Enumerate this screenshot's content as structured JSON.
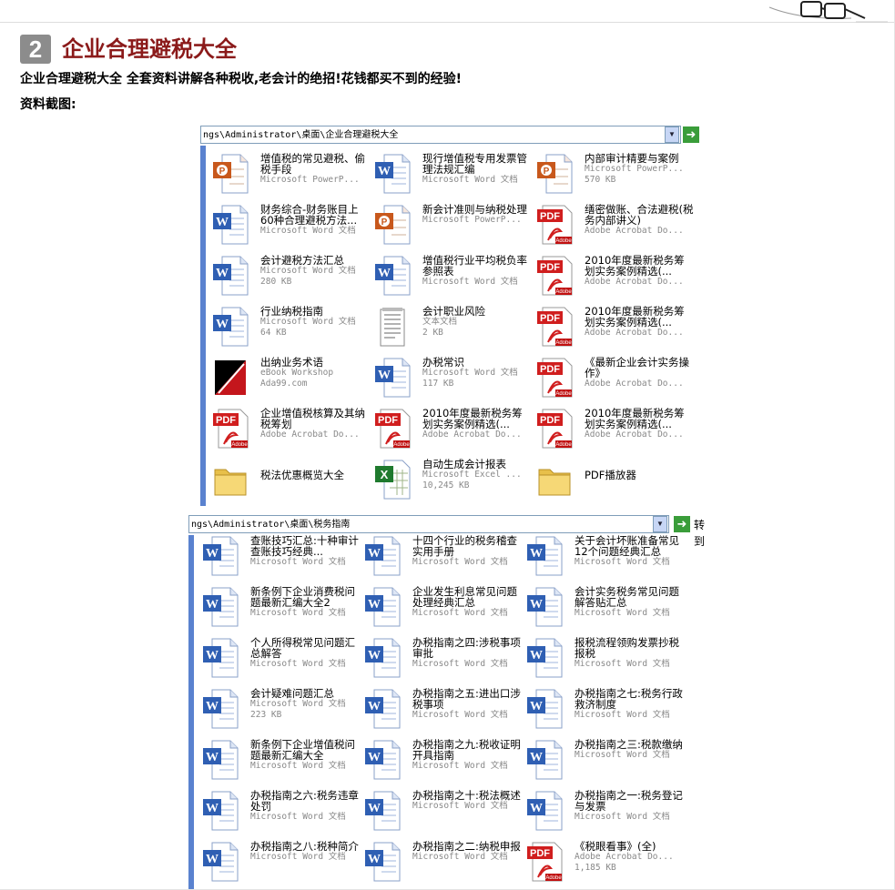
{
  "section": {
    "number": "2",
    "title": "企业合理避税大全"
  },
  "description": "企业合理避税大全 全套资料讲解各种税收,老会计的绝招!花钱都买不到的经验!",
  "screenshots_label": "资料截图:",
  "explorer1": {
    "address": "ngs\\Administrator\\桌面\\企业合理避税大全",
    "items": [
      {
        "icon": "ppt",
        "name": "增值税的常见避税、偷税手段",
        "meta1": "Microsoft PowerP...",
        "meta2": ""
      },
      {
        "icon": "word",
        "name": "现行增值税专用发票管理法规汇编",
        "meta1": "Microsoft Word 文档",
        "meta2": ""
      },
      {
        "icon": "ppt",
        "name": "内部审计精要与案例",
        "meta1": "Microsoft PowerP...",
        "meta2": "570 KB"
      },
      {
        "icon": "word",
        "name": "财务综合-财务账目上60种合理避税方法...",
        "meta1": "Microsoft Word 文档",
        "meta2": ""
      },
      {
        "icon": "ppt",
        "name": "新会计准则与纳税处理",
        "meta1": "Microsoft PowerP...",
        "meta2": ""
      },
      {
        "icon": "pdf",
        "name": "缮密做账、合法避税(税务内部讲义)",
        "meta1": "Adobe Acrobat Do...",
        "meta2": ""
      },
      {
        "icon": "word",
        "name": "会计避税方法汇总",
        "meta1": "Microsoft Word 文档",
        "meta2": "280 KB"
      },
      {
        "icon": "word",
        "name": "增值税行业平均税负率参照表",
        "meta1": "Microsoft Word 文档",
        "meta2": ""
      },
      {
        "icon": "pdf",
        "name": "2010年度最新税务筹划实务案例精选(...",
        "meta1": "Adobe Acrobat Do...",
        "meta2": ""
      },
      {
        "icon": "word",
        "name": "行业纳税指南",
        "meta1": "Microsoft Word 文档",
        "meta2": "64 KB"
      },
      {
        "icon": "txt",
        "name": "会计职业风险",
        "meta1": "文本文档",
        "meta2": "2 KB"
      },
      {
        "icon": "pdf",
        "name": "2010年度最新税务筹划实务案例精选(...",
        "meta1": "Adobe Acrobat Do...",
        "meta2": ""
      },
      {
        "icon": "ebook",
        "name": "出纳业务术语",
        "meta1": "eBook Workshop",
        "meta2": "Ada99.com"
      },
      {
        "icon": "word",
        "name": "办税常识",
        "meta1": "Microsoft Word 文档",
        "meta2": "117 KB"
      },
      {
        "icon": "pdf",
        "name": "《最新企业会计实务操作》",
        "meta1": "Adobe Acrobat Do...",
        "meta2": ""
      },
      {
        "icon": "pdf",
        "name": "企业增值税核算及其纳税筹划",
        "meta1": "Adobe Acrobat Do...",
        "meta2": ""
      },
      {
        "icon": "pdf",
        "name": "2010年度最新税务筹划实务案例精选(...",
        "meta1": "Adobe Acrobat Do...",
        "meta2": ""
      },
      {
        "icon": "pdf",
        "name": "2010年度最新税务筹划实务案例精选(...",
        "meta1": "Adobe Acrobat Do...",
        "meta2": ""
      },
      {
        "icon": "folder",
        "name": "税法优惠概览大全",
        "meta1": "",
        "meta2": ""
      },
      {
        "icon": "excel",
        "name": "自动生成会计报表",
        "meta1": "Microsoft Excel ...",
        "meta2": "10,245 KB"
      },
      {
        "icon": "folder",
        "name": "PDF播放器",
        "meta1": "",
        "meta2": ""
      }
    ]
  },
  "explorer2": {
    "address": "ngs\\Administrator\\桌面\\税务指南",
    "go_label": "转到",
    "items": [
      {
        "icon": "word",
        "name": "查账技巧汇总:十种审计查账技巧经典...",
        "meta1": "Microsoft Word 文档",
        "meta2": ""
      },
      {
        "icon": "word",
        "name": "十四个行业的税务稽查实用手册",
        "meta1": "Microsoft Word 文档",
        "meta2": ""
      },
      {
        "icon": "word",
        "name": "关于会计坏账准备常见12个问题经典汇总",
        "meta1": "Microsoft Word 文档",
        "meta2": ""
      },
      {
        "icon": "word",
        "name": "新条例下企业消费税问题最新汇编大全2",
        "meta1": "Microsoft Word 文档",
        "meta2": ""
      },
      {
        "icon": "word",
        "name": "企业发生利息常见问题处理经典汇总",
        "meta1": "Microsoft Word 文档",
        "meta2": ""
      },
      {
        "icon": "word",
        "name": "会计实务税务常见问题解答贴汇总",
        "meta1": "Microsoft Word 文档",
        "meta2": ""
      },
      {
        "icon": "word",
        "name": "个人所得税常见问题汇总解答",
        "meta1": "Microsoft Word 文档",
        "meta2": ""
      },
      {
        "icon": "word",
        "name": "办税指南之四:涉税事项审批",
        "meta1": "Microsoft Word 文档",
        "meta2": ""
      },
      {
        "icon": "word",
        "name": "报税流程领购发票抄税报税",
        "meta1": "Microsoft Word 文档",
        "meta2": ""
      },
      {
        "icon": "word",
        "name": "会计疑难问题汇总",
        "meta1": "Microsoft Word 文档",
        "meta2": "223 KB"
      },
      {
        "icon": "word",
        "name": "办税指南之五:进出口涉税事项",
        "meta1": "Microsoft Word 文档",
        "meta2": ""
      },
      {
        "icon": "word",
        "name": "办税指南之七:税务行政救济制度",
        "meta1": "Microsoft Word 文档",
        "meta2": ""
      },
      {
        "icon": "word",
        "name": "新条例下企业增值税问题最新汇编大全",
        "meta1": "Microsoft Word 文档",
        "meta2": ""
      },
      {
        "icon": "word",
        "name": "办税指南之九:税收证明开具指南",
        "meta1": "Microsoft Word 文档",
        "meta2": ""
      },
      {
        "icon": "word",
        "name": "办税指南之三:税款缴纳",
        "meta1": "Microsoft Word 文档",
        "meta2": ""
      },
      {
        "icon": "word",
        "name": "办税指南之六:税务违章处罚",
        "meta1": "Microsoft Word 文档",
        "meta2": ""
      },
      {
        "icon": "word",
        "name": "办税指南之十:税法概述",
        "meta1": "Microsoft Word 文档",
        "meta2": ""
      },
      {
        "icon": "word",
        "name": "办税指南之一:税务登记与发票",
        "meta1": "Microsoft Word 文档",
        "meta2": ""
      },
      {
        "icon": "word",
        "name": "办税指南之八:税种简介",
        "meta1": "Microsoft Word 文档",
        "meta2": ""
      },
      {
        "icon": "word",
        "name": "办税指南之二:纳税申报",
        "meta1": "Microsoft Word 文档",
        "meta2": ""
      },
      {
        "icon": "pdf",
        "name": "《税眼看事》(全)",
        "meta1": "Adobe Acrobat Do...",
        "meta2": "1,185 KB"
      }
    ]
  }
}
